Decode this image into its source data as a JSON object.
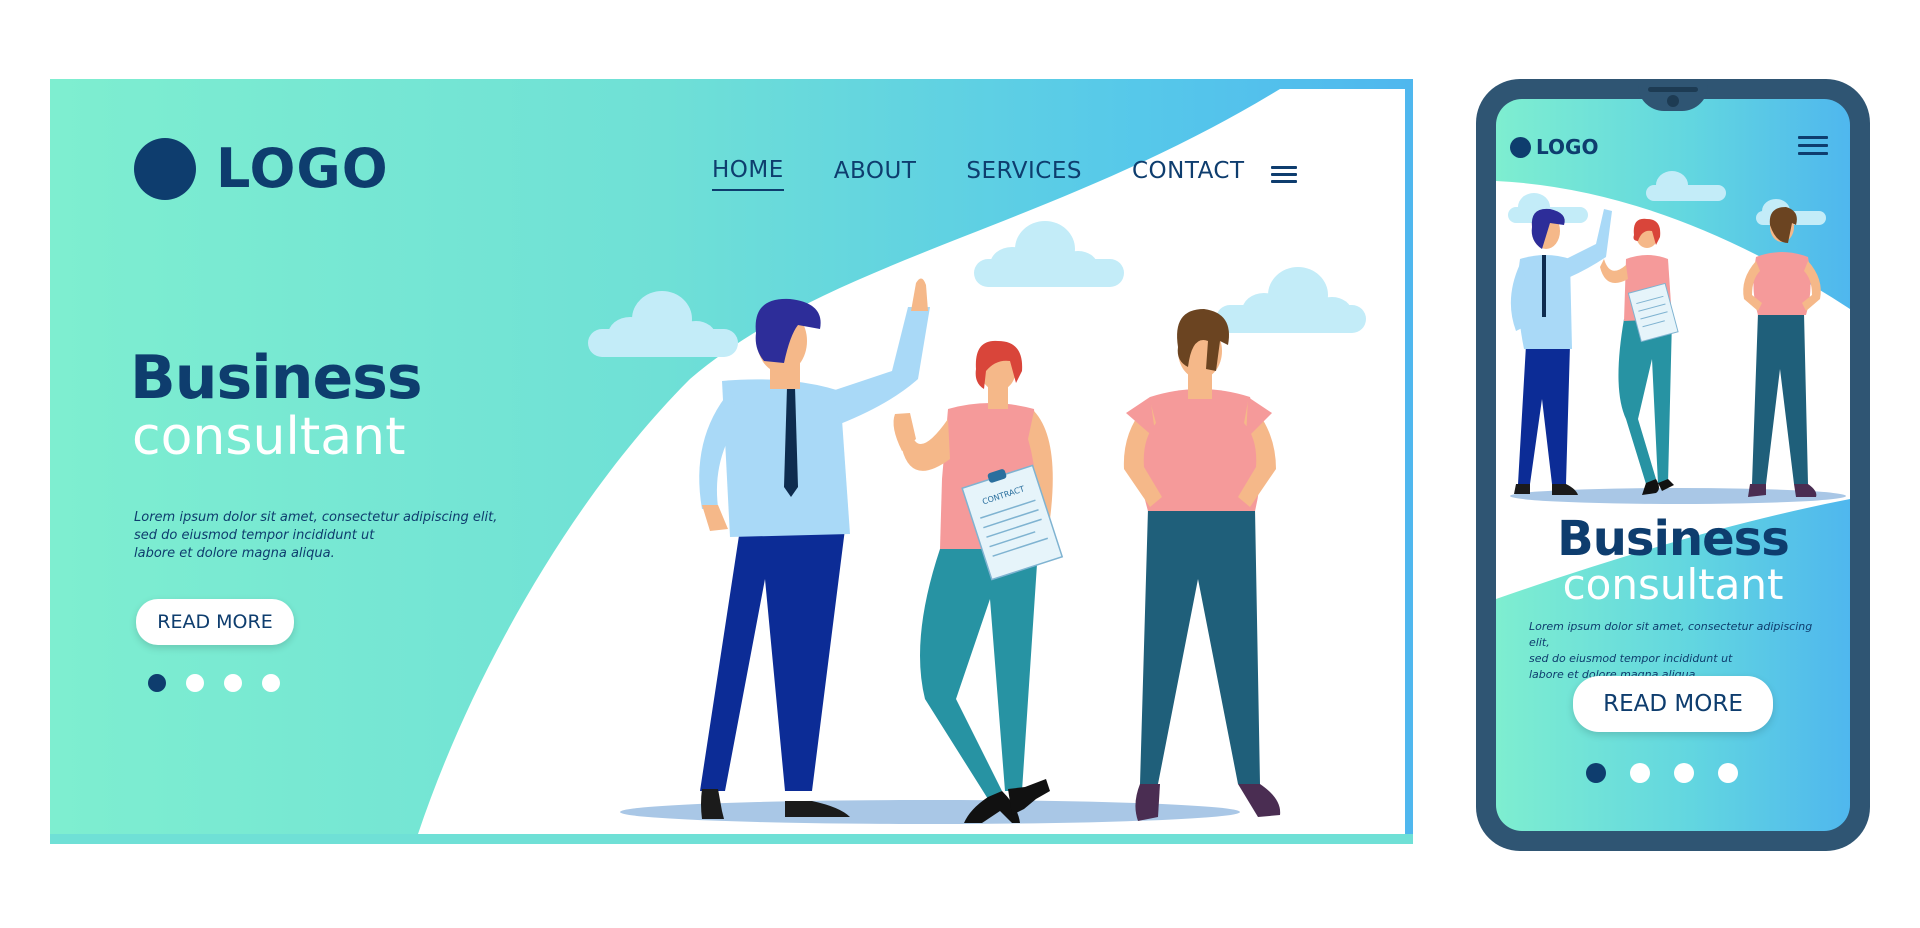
{
  "desktop": {
    "logo": "LOGO",
    "nav": {
      "home": "HOME",
      "about": "ABOUT",
      "services": "SERVICES",
      "contact": "CONTACT"
    },
    "hero": {
      "title": "Business",
      "subtitle": "consultant",
      "body": [
        "Lorem ipsum dolor sit amet, consectetur adipiscing elit,",
        "sed do eiusmod tempor incididunt ut",
        "labore et dolore magna aliqua."
      ],
      "cta": "READ MORE"
    },
    "clipboard_label": "CONTRACT",
    "slide_count": 4,
    "active_slide": 1
  },
  "mobile": {
    "logo": "LOGO",
    "hero": {
      "title": "Business",
      "subtitle": "consultant",
      "body": [
        "Lorem ipsum dolor sit amet, consectetur adipiscing elit,",
        "sed do eiusmod tempor incididunt ut",
        "labore et dolore magna aliqua."
      ],
      "cta": "READ MORE"
    },
    "slide_count": 4,
    "active_slide": 1
  },
  "colors": {
    "navy": "#0e3d6e",
    "mint": "#7eeed0",
    "sky": "#4fb7ee",
    "phone_frame": "#2f5573",
    "cloud": "#c3ecf8",
    "shirt_blue": "#a9d9f7",
    "shirt_pink": "#f59a9a",
    "pants_navy": "#0c2c96",
    "pants_teal": "#1f5f7a"
  }
}
